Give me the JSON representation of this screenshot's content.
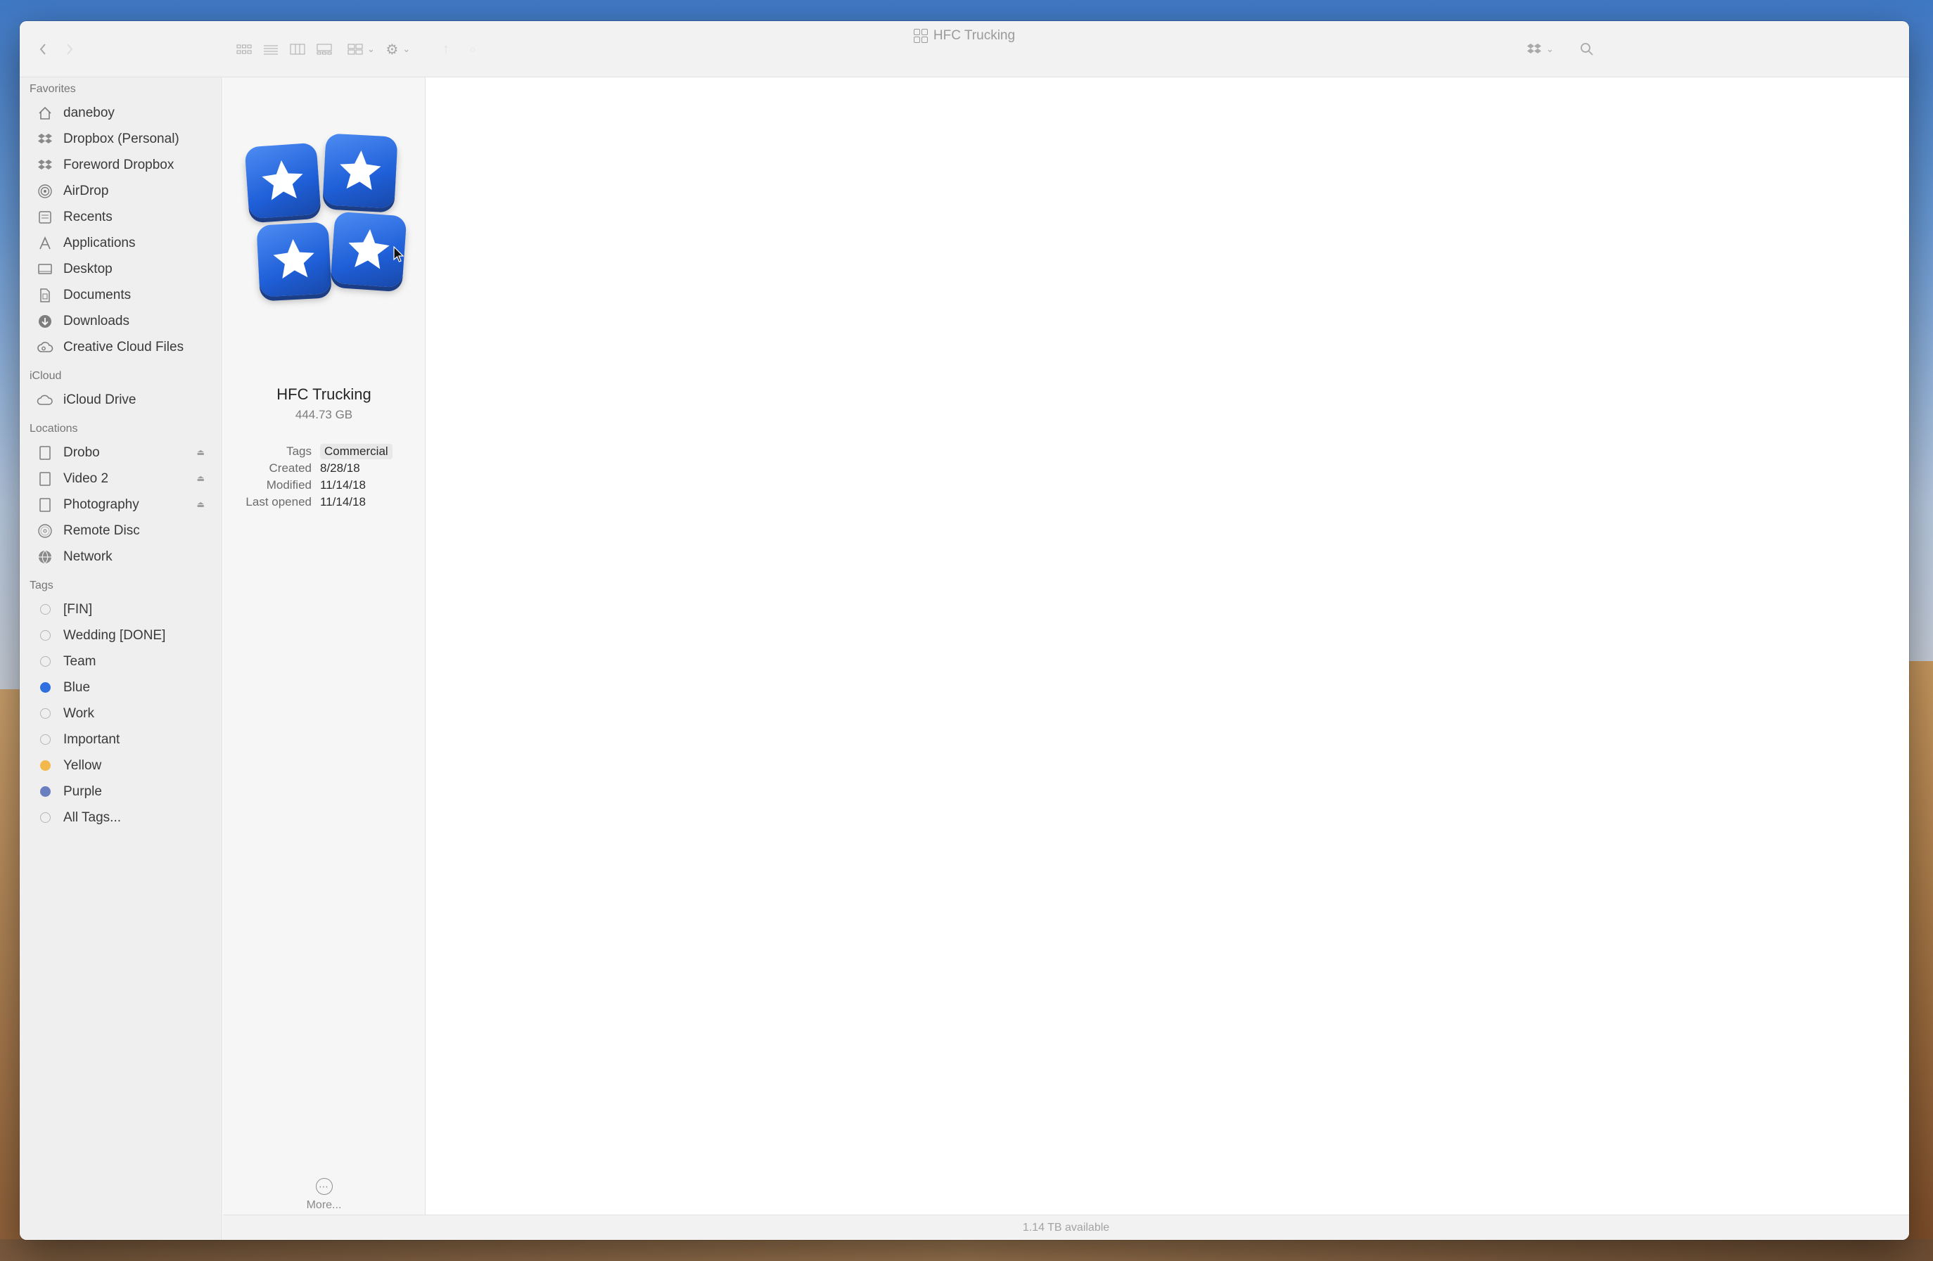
{
  "window": {
    "title": "HFC Trucking",
    "status": "1.14 TB available"
  },
  "toolbar": {
    "back_icon": "chevron-left-icon",
    "view_icons": [
      "icon-view-icon",
      "list-view-icon",
      "column-view-icon",
      "gallery-view-icon"
    ],
    "group_icon": "group-icon",
    "action_icon": "gear-icon",
    "dropbox_icon": "dropbox-icon",
    "search_icon": "magnifier-icon"
  },
  "sidebar": {
    "favorites_header": "Favorites",
    "favorites": [
      {
        "label": "daneboy",
        "icon": "house-icon"
      },
      {
        "label": "Dropbox (Personal)",
        "icon": "dropbox-icon"
      },
      {
        "label": "Foreword Dropbox",
        "icon": "dropbox-icon"
      },
      {
        "label": "AirDrop",
        "icon": "airdrop-icon"
      },
      {
        "label": "Recents",
        "icon": "clock-icon"
      },
      {
        "label": "Applications",
        "icon": "applications-icon"
      },
      {
        "label": "Desktop",
        "icon": "desktop-icon"
      },
      {
        "label": "Documents",
        "icon": "document-icon"
      },
      {
        "label": "Downloads",
        "icon": "download-icon"
      },
      {
        "label": "Creative Cloud Files",
        "icon": "creative-cloud-icon"
      }
    ],
    "icloud_header": "iCloud",
    "icloud": [
      {
        "label": "iCloud Drive",
        "icon": "cloud-icon"
      }
    ],
    "locations_header": "Locations",
    "locations": [
      {
        "label": "Drobo",
        "icon": "drive-icon",
        "eject": true
      },
      {
        "label": "Video 2",
        "icon": "drive-icon",
        "eject": true
      },
      {
        "label": "Photography",
        "icon": "drive-icon",
        "eject": true
      },
      {
        "label": "Remote Disc",
        "icon": "disc-icon",
        "eject": false
      },
      {
        "label": "Network",
        "icon": "globe-icon",
        "eject": false
      }
    ],
    "tags_header": "Tags",
    "tags": [
      {
        "label": "[FIN]",
        "color": ""
      },
      {
        "label": "Wedding [DONE]",
        "color": ""
      },
      {
        "label": "Team",
        "color": ""
      },
      {
        "label": "Blue",
        "color": "#2f6fe0"
      },
      {
        "label": "Work",
        "color": ""
      },
      {
        "label": "Important",
        "color": ""
      },
      {
        "label": "Yellow",
        "color": "#f2b84b"
      },
      {
        "label": "Purple",
        "color": "#6a7fbf"
      },
      {
        "label": "All Tags...",
        "color": ""
      }
    ]
  },
  "preview": {
    "name": "HFC Trucking",
    "size": "444.73 GB",
    "meta": {
      "tags_label": "Tags",
      "tags_value": "Commercial",
      "created_label": "Created",
      "created_value": "8/28/18",
      "modified_label": "Modified",
      "modified_value": "11/14/18",
      "opened_label": "Last opened",
      "opened_value": "11/14/18"
    },
    "more_label": "More..."
  },
  "colors": {
    "accent_blue": "#2f6fe0",
    "sidebar_bg": "#f0eff0"
  }
}
